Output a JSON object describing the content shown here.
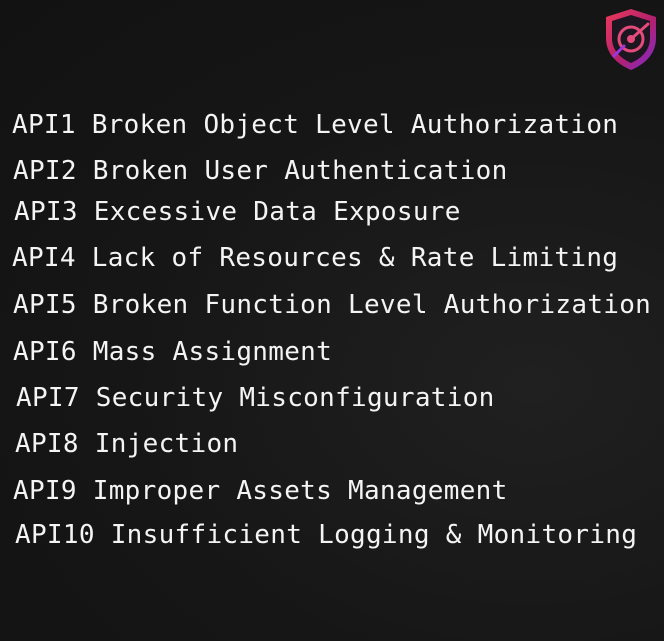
{
  "logo": {
    "icon": "shield-logo-icon",
    "colors": [
      "#e8315c",
      "#8a2be2",
      "#c2185b"
    ]
  },
  "items": [
    "API1 Broken Object Level Authorization",
    "API2 Broken User Authentication",
    "API3 Excessive Data Exposure",
    "API4 Lack of Resources & Rate Limiting",
    "API5 Broken Function Level Authorization",
    "API6 Mass Assignment",
    "API7 Security Misconfiguration",
    "API8 Injection",
    "API9 Improper Assets Management",
    "API10 Insufficient Logging & Monitoring"
  ]
}
